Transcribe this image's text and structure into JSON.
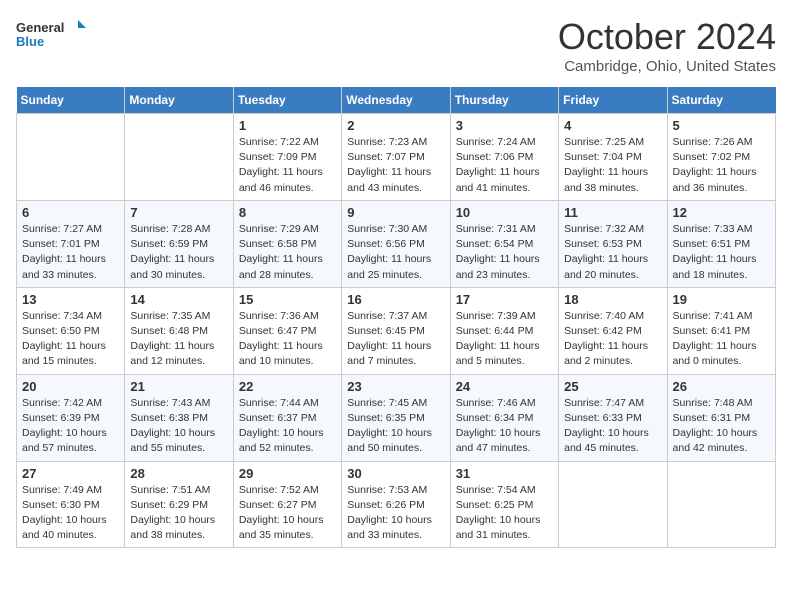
{
  "header": {
    "logo_general": "General",
    "logo_blue": "Blue",
    "month": "October 2024",
    "location": "Cambridge, Ohio, United States"
  },
  "days_of_week": [
    "Sunday",
    "Monday",
    "Tuesday",
    "Wednesday",
    "Thursday",
    "Friday",
    "Saturday"
  ],
  "weeks": [
    [
      {
        "day": "",
        "info": ""
      },
      {
        "day": "",
        "info": ""
      },
      {
        "day": "1",
        "info": "Sunrise: 7:22 AM\nSunset: 7:09 PM\nDaylight: 11 hours and 46 minutes."
      },
      {
        "day": "2",
        "info": "Sunrise: 7:23 AM\nSunset: 7:07 PM\nDaylight: 11 hours and 43 minutes."
      },
      {
        "day": "3",
        "info": "Sunrise: 7:24 AM\nSunset: 7:06 PM\nDaylight: 11 hours and 41 minutes."
      },
      {
        "day": "4",
        "info": "Sunrise: 7:25 AM\nSunset: 7:04 PM\nDaylight: 11 hours and 38 minutes."
      },
      {
        "day": "5",
        "info": "Sunrise: 7:26 AM\nSunset: 7:02 PM\nDaylight: 11 hours and 36 minutes."
      }
    ],
    [
      {
        "day": "6",
        "info": "Sunrise: 7:27 AM\nSunset: 7:01 PM\nDaylight: 11 hours and 33 minutes."
      },
      {
        "day": "7",
        "info": "Sunrise: 7:28 AM\nSunset: 6:59 PM\nDaylight: 11 hours and 30 minutes."
      },
      {
        "day": "8",
        "info": "Sunrise: 7:29 AM\nSunset: 6:58 PM\nDaylight: 11 hours and 28 minutes."
      },
      {
        "day": "9",
        "info": "Sunrise: 7:30 AM\nSunset: 6:56 PM\nDaylight: 11 hours and 25 minutes."
      },
      {
        "day": "10",
        "info": "Sunrise: 7:31 AM\nSunset: 6:54 PM\nDaylight: 11 hours and 23 minutes."
      },
      {
        "day": "11",
        "info": "Sunrise: 7:32 AM\nSunset: 6:53 PM\nDaylight: 11 hours and 20 minutes."
      },
      {
        "day": "12",
        "info": "Sunrise: 7:33 AM\nSunset: 6:51 PM\nDaylight: 11 hours and 18 minutes."
      }
    ],
    [
      {
        "day": "13",
        "info": "Sunrise: 7:34 AM\nSunset: 6:50 PM\nDaylight: 11 hours and 15 minutes."
      },
      {
        "day": "14",
        "info": "Sunrise: 7:35 AM\nSunset: 6:48 PM\nDaylight: 11 hours and 12 minutes."
      },
      {
        "day": "15",
        "info": "Sunrise: 7:36 AM\nSunset: 6:47 PM\nDaylight: 11 hours and 10 minutes."
      },
      {
        "day": "16",
        "info": "Sunrise: 7:37 AM\nSunset: 6:45 PM\nDaylight: 11 hours and 7 minutes."
      },
      {
        "day": "17",
        "info": "Sunrise: 7:39 AM\nSunset: 6:44 PM\nDaylight: 11 hours and 5 minutes."
      },
      {
        "day": "18",
        "info": "Sunrise: 7:40 AM\nSunset: 6:42 PM\nDaylight: 11 hours and 2 minutes."
      },
      {
        "day": "19",
        "info": "Sunrise: 7:41 AM\nSunset: 6:41 PM\nDaylight: 11 hours and 0 minutes."
      }
    ],
    [
      {
        "day": "20",
        "info": "Sunrise: 7:42 AM\nSunset: 6:39 PM\nDaylight: 10 hours and 57 minutes."
      },
      {
        "day": "21",
        "info": "Sunrise: 7:43 AM\nSunset: 6:38 PM\nDaylight: 10 hours and 55 minutes."
      },
      {
        "day": "22",
        "info": "Sunrise: 7:44 AM\nSunset: 6:37 PM\nDaylight: 10 hours and 52 minutes."
      },
      {
        "day": "23",
        "info": "Sunrise: 7:45 AM\nSunset: 6:35 PM\nDaylight: 10 hours and 50 minutes."
      },
      {
        "day": "24",
        "info": "Sunrise: 7:46 AM\nSunset: 6:34 PM\nDaylight: 10 hours and 47 minutes."
      },
      {
        "day": "25",
        "info": "Sunrise: 7:47 AM\nSunset: 6:33 PM\nDaylight: 10 hours and 45 minutes."
      },
      {
        "day": "26",
        "info": "Sunrise: 7:48 AM\nSunset: 6:31 PM\nDaylight: 10 hours and 42 minutes."
      }
    ],
    [
      {
        "day": "27",
        "info": "Sunrise: 7:49 AM\nSunset: 6:30 PM\nDaylight: 10 hours and 40 minutes."
      },
      {
        "day": "28",
        "info": "Sunrise: 7:51 AM\nSunset: 6:29 PM\nDaylight: 10 hours and 38 minutes."
      },
      {
        "day": "29",
        "info": "Sunrise: 7:52 AM\nSunset: 6:27 PM\nDaylight: 10 hours and 35 minutes."
      },
      {
        "day": "30",
        "info": "Sunrise: 7:53 AM\nSunset: 6:26 PM\nDaylight: 10 hours and 33 minutes."
      },
      {
        "day": "31",
        "info": "Sunrise: 7:54 AM\nSunset: 6:25 PM\nDaylight: 10 hours and 31 minutes."
      },
      {
        "day": "",
        "info": ""
      },
      {
        "day": "",
        "info": ""
      }
    ]
  ]
}
